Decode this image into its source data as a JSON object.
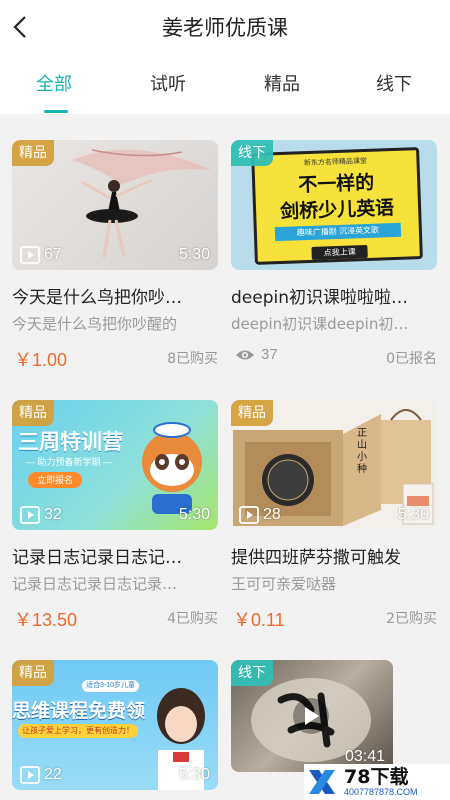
{
  "header": {
    "title": "姜老师优质课"
  },
  "tabs": [
    {
      "label": "全部",
      "active": true
    },
    {
      "label": "试听",
      "active": false
    },
    {
      "label": "精品",
      "active": false
    },
    {
      "label": "线下",
      "active": false
    }
  ],
  "colors": {
    "accent": "#1ab3b3",
    "price": "#f06a2b",
    "badge_premium": "#d4a03c",
    "badge_offline": "#32beb4"
  },
  "cards": [
    {
      "badge": "精品",
      "count": "67",
      "duration": "5:30",
      "title": "今天是什么鸟把你吵…",
      "subtitle": "今天是什么鸟把你吵醒的",
      "price": "￥1.00",
      "stat": "8已购买",
      "icon": "play-square-icon"
    },
    {
      "badge": "线下",
      "poster_title": "不一样的",
      "poster_title2": "剑桥少儿英语",
      "poster_top": "新东方名师精品课堂",
      "poster_band": "趣味广播剧  沉浸英文歌",
      "poster_btn": "点我上课",
      "title": "deepin初识课啦啦啦…",
      "subtitle": "deepin初识课deepin初…",
      "views": "37",
      "stat": "0已报名",
      "icon": "eye-icon"
    },
    {
      "badge": "精品",
      "poster_title": "三周特训营",
      "poster_sub": "— 助力预备新学期 —",
      "poster_btn": "立即报名",
      "count": "32",
      "duration": "5:30",
      "title": "记录日志记录日志记…",
      "subtitle": "记录日志记录日志记录…",
      "price": "￥13.50",
      "stat": "4已购买"
    },
    {
      "badge": "精品",
      "poster_title": "正山小种",
      "count": "28",
      "duration": "5:30",
      "title": "提供四班萨芬撒可触发",
      "subtitle": "王可可亲爱哒器",
      "price": "￥0.11",
      "stat": "2已购买"
    },
    {
      "badge": "精品",
      "poster_title": "思维课程免费领",
      "poster_tag": "适合3-10岁儿童",
      "poster_sub": "让孩子爱上学习，更有创造力！",
      "count": "22",
      "duration": "5:30"
    },
    {
      "badge": "线下",
      "duration": "03:41"
    }
  ],
  "watermark": {
    "main": "78下载",
    "sub": "4007787878.COM"
  }
}
